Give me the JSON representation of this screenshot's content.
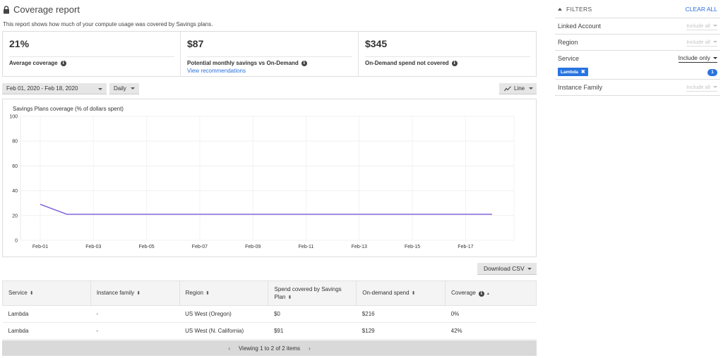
{
  "header": {
    "title": "Coverage report",
    "subtitle": "This report shows how much of your compute usage was covered by Savings plans."
  },
  "kpis": [
    {
      "value": "21%",
      "label": "Average coverage"
    },
    {
      "value": "$87",
      "label": "Potential monthly savings vs On-Demand",
      "link": "View recommendations"
    },
    {
      "value": "$345",
      "label": "On-Demand spend not covered"
    }
  ],
  "controls": {
    "date_range": "Feb 01, 2020 - Feb 18, 2020",
    "granularity": "Daily",
    "chart_type": "Line",
    "download": "Download CSV"
  },
  "chart_data": {
    "type": "line",
    "title": "Savings Plans coverage (% of dollars spent)",
    "xlabel": "",
    "ylabel": "",
    "ylim": [
      0,
      100
    ],
    "yticks": [
      0,
      20,
      40,
      60,
      80,
      100
    ],
    "x": [
      "Feb-01",
      "Feb-02",
      "Feb-03",
      "Feb-04",
      "Feb-05",
      "Feb-06",
      "Feb-07",
      "Feb-08",
      "Feb-09",
      "Feb-10",
      "Feb-11",
      "Feb-12",
      "Feb-13",
      "Feb-14",
      "Feb-15",
      "Feb-16",
      "Feb-17",
      "Feb-18"
    ],
    "xtick_labels": [
      "Feb-01",
      "Feb-03",
      "Feb-05",
      "Feb-07",
      "Feb-09",
      "Feb-11",
      "Feb-13",
      "Feb-15",
      "Feb-17"
    ],
    "series": [
      {
        "name": "Coverage",
        "color": "#7b5cdb",
        "values": [
          29,
          21,
          21,
          21,
          21,
          21,
          21,
          21,
          21,
          21,
          21,
          21,
          21,
          21,
          21,
          21,
          21,
          21
        ]
      }
    ],
    "grid": true
  },
  "table": {
    "columns": [
      {
        "label": "Service",
        "sort": "both"
      },
      {
        "label": "Instance family",
        "sort": "both"
      },
      {
        "label": "Region",
        "sort": "both"
      },
      {
        "label": "Spend covered by Savings Plan",
        "sort": "both"
      },
      {
        "label": "On-demand spend",
        "sort": "both"
      },
      {
        "label": "Coverage",
        "sort": "asc",
        "info": true
      }
    ],
    "rows": [
      [
        "Lambda",
        "-",
        "US West (Oregon)",
        "$0",
        "$216",
        "0%"
      ],
      [
        "Lambda",
        "-",
        "US West (N. California)",
        "$91",
        "$129",
        "42%"
      ]
    ],
    "pager": "Viewing 1 to 2 of 2 items"
  },
  "filters": {
    "title": "FILTERS",
    "clear_all": "CLEAR ALL",
    "items": [
      {
        "name": "Linked Account",
        "mode": "Include all"
      },
      {
        "name": "Region",
        "mode": "Include all"
      },
      {
        "name": "Service",
        "mode": "Include only",
        "chips": [
          "Lambda"
        ],
        "count": "1"
      },
      {
        "name": "Instance Family",
        "mode": "Include all"
      }
    ]
  },
  "colors": {
    "accent": "#2a74e0",
    "line": "#7b5cdb"
  }
}
